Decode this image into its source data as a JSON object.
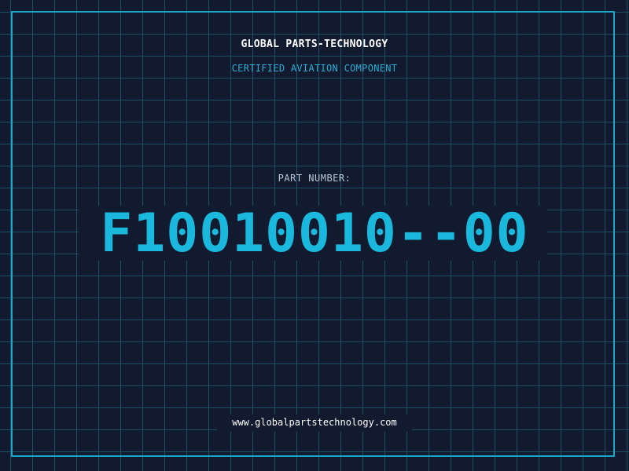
{
  "header": {
    "company": "GLOBAL PARTS-TECHNOLOGY",
    "subtitle": "CERTIFIED AVIATION COMPONENT"
  },
  "part": {
    "label": "PART NUMBER:",
    "number": "F10010010--00"
  },
  "footer": {
    "url": "www.globalpartstechnology.com"
  },
  "colors": {
    "background": "#111a2e",
    "grid": "#1f4f63",
    "accent": "#19b8dc",
    "text": "#ffffff"
  }
}
